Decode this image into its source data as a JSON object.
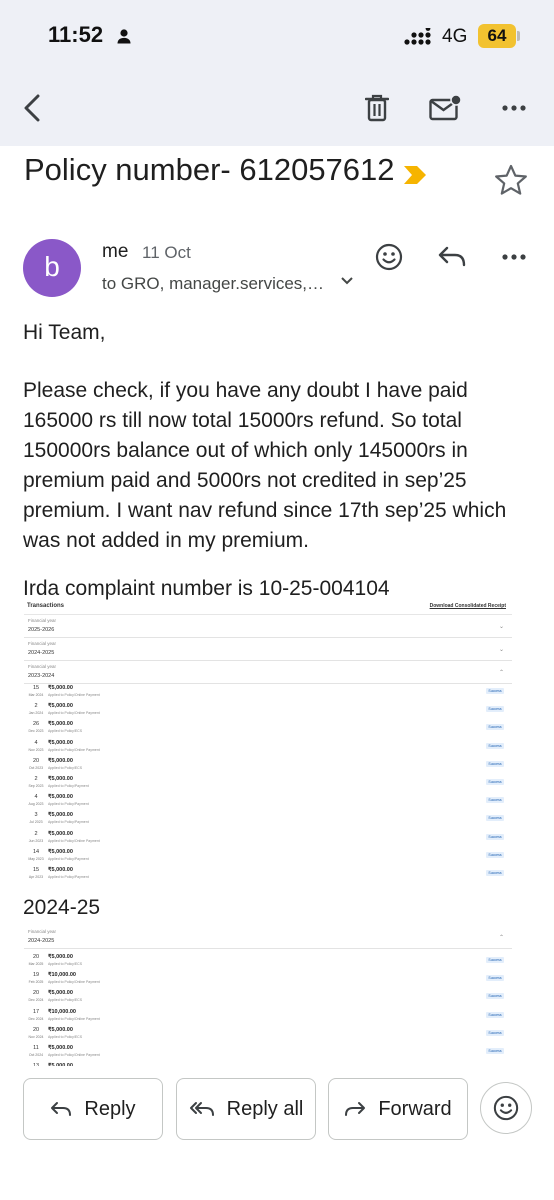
{
  "status_bar": {
    "time": "11:52",
    "network": "4G",
    "battery": "64"
  },
  "subject": "Policy number- 612057612",
  "message": {
    "avatar_letter": "b",
    "sender": "me",
    "date": "11 Oct",
    "recipients": "to GRO, manager.services,…",
    "greeting": "Hi Team,",
    "paragraph": "Please check, if you have any doubt I have paid 165000 rs till now total 15000rs refund. So total 150000rs balance out of which only 145000rs in premium paid and 5000rs not credited in sep’25 premium. I want nav refund since 17th sep’25 which was not added in my premium.",
    "complaint": "Irda complaint number is 10-25-004104",
    "year_label": "2024-25"
  },
  "screenshot1": {
    "title": "Transactions",
    "download_link": "Download Consolidated Receipt",
    "fy_label": "Financial year",
    "years": [
      "2025-2026",
      "2024-2025",
      "2023-2024"
    ],
    "transactions": [
      {
        "day": "15",
        "month": "Mar 2024",
        "amount": "₹5,000.00",
        "desc": "Applied to Policy/Online Payment",
        "status": "Success"
      },
      {
        "day": "2",
        "month": "Jan 2024",
        "amount": "₹5,000.00",
        "desc": "Applied to Policy/Online Payment",
        "status": "Success"
      },
      {
        "day": "26",
        "month": "Dec 2023",
        "amount": "₹5,000.00",
        "desc": "Applied to Policy/ECS",
        "status": "Success"
      },
      {
        "day": "4",
        "month": "Nov 2023",
        "amount": "₹5,000.00",
        "desc": "Applied to Policy/Online Payment",
        "status": "Success"
      },
      {
        "day": "20",
        "month": "Oct 2023",
        "amount": "₹5,000.00",
        "desc": "Applied to Policy/ECS",
        "status": "Success"
      },
      {
        "day": "2",
        "month": "Sep 2023",
        "amount": "₹5,000.00",
        "desc": "Applied to Policy/Payment",
        "status": "Success"
      },
      {
        "day": "4",
        "month": "Aug 2023",
        "amount": "₹5,000.00",
        "desc": "Applied to Policy/Payment",
        "status": "Success"
      },
      {
        "day": "3",
        "month": "Jul 2023",
        "amount": "₹5,000.00",
        "desc": "Applied to Policy/Payment",
        "status": "Success"
      },
      {
        "day": "2",
        "month": "Jun 2023",
        "amount": "₹5,000.00",
        "desc": "Applied to Policy/Online Payment",
        "status": "Success"
      },
      {
        "day": "14",
        "month": "May 2023",
        "amount": "₹5,000.00",
        "desc": "Applied to Policy/Payment",
        "status": "Success"
      },
      {
        "day": "15",
        "month": "Apr 2023",
        "amount": "₹5,000.00",
        "desc": "Applied to Policy/Payment",
        "status": "Success"
      }
    ]
  },
  "screenshot2": {
    "fy_label": "Financial year",
    "year": "2024-2025",
    "transactions": [
      {
        "day": "20",
        "month": "Mar 2025",
        "amount": "₹5,000.00",
        "desc": "Applied to Policy/ECS",
        "status": "Success"
      },
      {
        "day": "19",
        "month": "Feb 2025",
        "amount": "₹10,000.00",
        "desc": "Applied to Policy/Online Payment",
        "status": "Success"
      },
      {
        "day": "20",
        "month": "Dec 2024",
        "amount": "₹5,000.00",
        "desc": "Applied to Policy/ECS",
        "status": "Success"
      },
      {
        "day": "17",
        "month": "Dec 2024",
        "amount": "₹10,000.00",
        "desc": "Applied to Policy/Online Payment",
        "status": "Success"
      },
      {
        "day": "20",
        "month": "Nov 2024",
        "amount": "₹5,000.00",
        "desc": "Applied to Policy/ECS",
        "status": "Success"
      },
      {
        "day": "11",
        "month": "Oct 2024",
        "amount": "₹5,000.00",
        "desc": "Applied to Policy/Online Payment",
        "status": "Success"
      },
      {
        "day": "13",
        "month": "",
        "amount": "₹5,000.00",
        "desc": "",
        "status": ""
      }
    ]
  },
  "actions": {
    "reply": "Reply",
    "reply_all": "Reply all",
    "forward": "Forward"
  },
  "colors": {
    "avatar": "#8a58c8",
    "label_tag": "#f6b400",
    "toolbar_bg": "#eef0f6",
    "battery": "#f2c230"
  },
  "icons": [
    "person-icon",
    "signal-icon",
    "back-arrow-icon",
    "delete-icon",
    "mark-unread-icon",
    "more-icon",
    "label-tag-icon",
    "star-icon",
    "emoji-icon",
    "reply-icon",
    "reply-all-icon",
    "forward-icon"
  ]
}
